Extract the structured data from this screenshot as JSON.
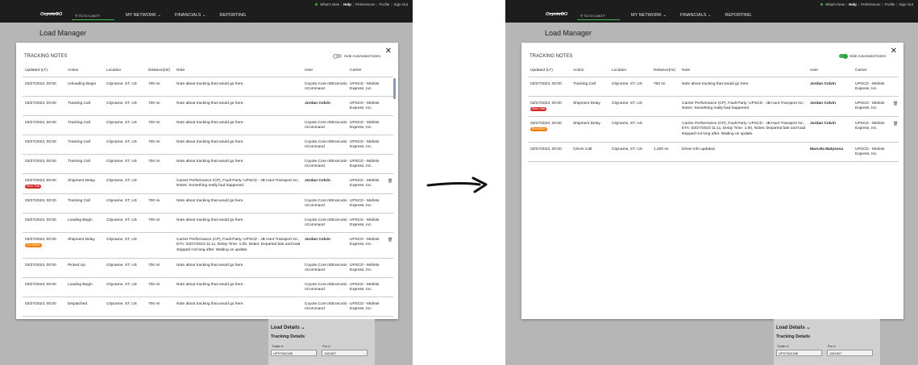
{
  "topbar": {
    "links": [
      "What's New",
      "Help",
      "Preferences",
      "Profile",
      "Sign Out"
    ]
  },
  "nav": {
    "logo": "CoyoteGO",
    "search_placeholder": "Go to Load #",
    "menu": [
      "MY NETWORK",
      "FINANCIALS",
      "REPORTING"
    ]
  },
  "page_title": "Load Manager",
  "modal": {
    "title": "TRACKING NOTES",
    "toggle_label": "Hide Automated Notes",
    "headers": [
      "Updated (LT)",
      "Action",
      "Location",
      "Distance(mi)",
      "Note",
      "User",
      "Carrier"
    ]
  },
  "left_rows": [
    {
      "date": "03/27/2023, 00:00",
      "action": "Unloading Begin",
      "location": "Cityname, ST, US",
      "distance": "700 mi",
      "note": "Note about tracking that would go here.",
      "user": "Coyote.Core.IISExecutionCommand",
      "carrier": "UPSCD - Midnite Express, Inc."
    },
    {
      "date": "03/27/2023, 00:00",
      "action": "Tracking Call",
      "location": "Cityname, ST, US",
      "distance": "700 mi",
      "note": "Note about tracking that would go here.",
      "user": "Jordan Colvin",
      "carrier": "UPSCD - Midnite Express, Inc."
    },
    {
      "date": "03/27/2023, 00:00",
      "action": "Tracking Call",
      "location": "Cityname, ST, US",
      "distance": "700 mi",
      "note": "Note about tracking that would go here.",
      "user": "Coyote.Core.IISExecutionCommand",
      "carrier": "UPSCD - Midnite Express, Inc."
    },
    {
      "date": "03/27/2023, 00:00",
      "action": "Tracking Call",
      "location": "Cityname, ST, US",
      "distance": "700 mi",
      "note": "Note about tracking that would go here.",
      "user": "Coyote.Core.IISExecutionCommand",
      "carrier": "UPSCD - Midnite Express, Inc."
    },
    {
      "date": "03/27/2023, 00:00",
      "action": "Tracking Call",
      "location": "Cityname, ST, US",
      "distance": "700 mi",
      "note": "Note about tracking that would go here.",
      "user": "Coyote.Core.IISExecutionCommand",
      "carrier": "UPSCD - Midnite Express, Inc."
    },
    {
      "date": "03/27/2023, 00:00",
      "badge": "Serv. Fail",
      "action": "Shipment Delay",
      "location": "Cityname, ST, US",
      "distance": "",
      "note": "Carrier Performance (CP), Fault Party: UPSCD - JB Hunt Transport Inc, Notes: Something really bad happened.",
      "user": "Jordan Colvin",
      "carrier": "UPSCD - Midnite Express, Inc."
    },
    {
      "date": "03/27/2023, 00:00",
      "action": "Tracking Call",
      "location": "Cityname, ST, US",
      "distance": "700 mi",
      "note": "Note about tracking that would go here.",
      "user": "Coyote.Core.IISExecutionCommand",
      "carrier": "UPSCD - Midnite Express, Inc."
    },
    {
      "date": "03/27/2023, 00:00",
      "action": "Loading Begin",
      "location": "Cityname, ST, US",
      "distance": "700 mi",
      "note": "Note about tracking that would go here.",
      "user": "Coyote.Core.IISExecutionCommand",
      "carrier": "UPSCD - Midnite Express, Inc."
    },
    {
      "date": "03/27/2023, 00:00",
      "badge": "Exception",
      "action": "Shipment Delay",
      "location": "Cityname, ST, US",
      "distance": "",
      "note": "Carrier Performance (CP), Fault Party: UPSCD - JB Hunt Transport Inc, ETA: 03/27/2023 11:11, Delay Time: 1:00, Notes: Departed late and load stopped not long after. Waiting on update.",
      "user": "Jordan Colvin",
      "carrier": "UPSCD - Midnite Express, Inc."
    },
    {
      "date": "03/27/2023, 00:00",
      "action": "Picked Up",
      "location": "Cityname, ST, US",
      "distance": "700 mi",
      "note": "Note about tracking that would go here.",
      "user": "Coyote.Core.IISExecutionCommand",
      "carrier": "UPSCD - Midnite Express, Inc."
    },
    {
      "date": "03/27/2023, 00:00",
      "action": "Loading Begin",
      "location": "Cityname, ST, US",
      "distance": "700 mi",
      "note": "Note about tracking that would go here.",
      "user": "Coyote.Core.IISExecutionCommand",
      "carrier": "UPSCD - Midnite Express, Inc."
    },
    {
      "date": "03/27/2023, 00:00",
      "action": "Dispatched",
      "location": "Cityname, ST, US",
      "distance": "700 mi",
      "note": "Note about tracking that would go here.",
      "user": "Coyote.Core.IISExecutionCommand",
      "carrier": "UPSCD - Midnite Express, Inc."
    }
  ],
  "right_rows": [
    {
      "date": "03/27/2023, 00:00",
      "action": "Tracking Call",
      "location": "Cityname, ST, US",
      "distance": "700 mi",
      "note": "Note about tracking that would go here.",
      "user": "Jordan Colvin",
      "carrier": "UPSCD - Midnite Express, Inc."
    },
    {
      "date": "03/27/2023, 00:00",
      "badge": "Serv. Fail",
      "action": "Shipment Delay",
      "location": "Cityname, ST, US",
      "distance": "",
      "note": "Carrier Performance (CP), Fault Party: UPSCD - JB Hunt Transport Inc, Notes: Something really bad happened.",
      "user": "Jordan Colvin",
      "carrier": "UPSCD - Midnite Express, Inc."
    },
    {
      "date": "03/27/2023, 00:00",
      "badge": "Exception",
      "action": "Shipment Delay",
      "location": "Cityname, ST, US",
      "distance": "",
      "note": "Carrier Performance (CP), Fault Party: UPSCD - JB Hunt Transport Inc, ETA: 03/27/2023 11:11, Delay Time: 1:00, Notes: Departed late and load stopped not long after. Waiting on update.",
      "user": "Jordan Colvin",
      "carrier": "UPSCD - Midnite Express, Inc."
    },
    {
      "date": "03/27/2023, 00:00",
      "action": "Check Call",
      "location": "Cityname, ST, US",
      "distance": "1,400 mi",
      "note": "Driver info updated.",
      "user": "Marcela Matysova",
      "carrier": "UPSCD - Midnite Express, Inc."
    }
  ],
  "details": {
    "title": "Load Details",
    "subtitle": "Tracking Details",
    "trailer_label": "Trailer #",
    "trailer_value": "UPST842186",
    "pro_label": "Pro #",
    "pro_value": "1181807"
  },
  "colors": {
    "accent": "#39b54a",
    "serv_fail": "#d32f2f",
    "exception": "#f57c00"
  }
}
